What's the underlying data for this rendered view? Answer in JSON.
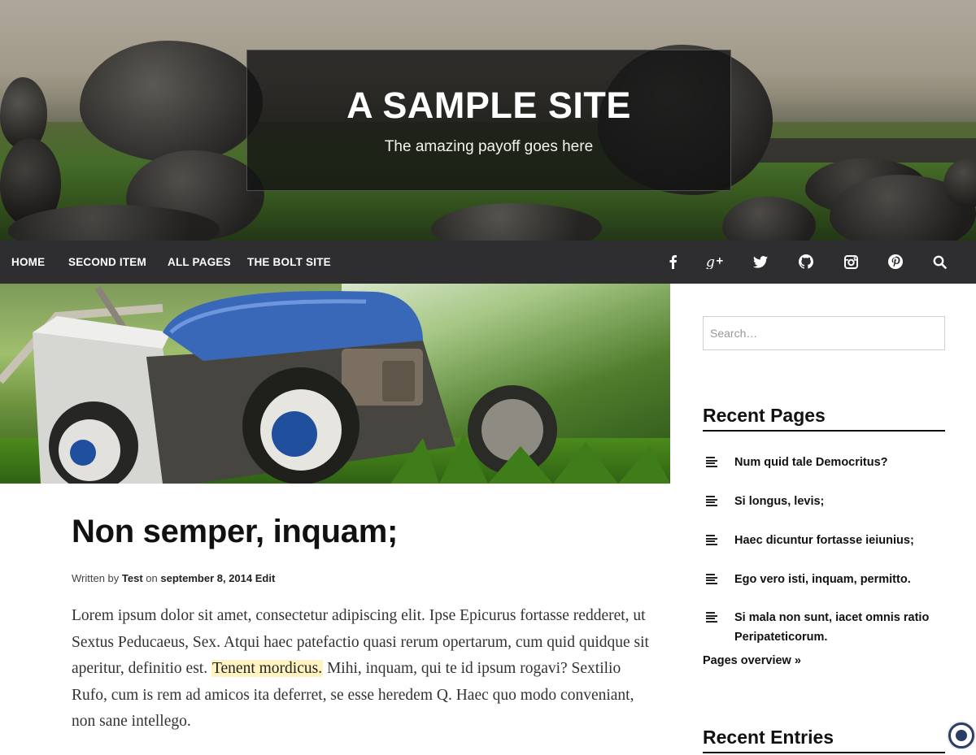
{
  "header": {
    "site_title": "A SAMPLE SITE",
    "tagline": "The amazing payoff goes here"
  },
  "nav": {
    "items": [
      {
        "label": "HOME"
      },
      {
        "label": "SECOND ITEM"
      },
      {
        "label": "ALL PAGES"
      },
      {
        "label": "THE BOLT SITE"
      }
    ],
    "social_icons": [
      "facebook-icon",
      "google-plus-icon",
      "twitter-icon",
      "github-icon",
      "instagram-icon",
      "pinterest-icon",
      "search-icon"
    ]
  },
  "post": {
    "title": "Non semper, inquam;",
    "meta_written_by": "Written by",
    "meta_author": "Test",
    "meta_on": "on",
    "meta_date": "september 8, 2014",
    "meta_edit": "Edit",
    "body_before": "Lorem ipsum dolor sit amet, consectetur adipiscing elit. Ipse Epicurus fortasse redderet, ut Sextus Peducaeus, Sex. Atqui haec patefactio quasi rerum opertarum, cum quid quidque sit aperitur, definitio est. ",
    "body_highlight": "Tenent mordicus.",
    "body_after": " Mihi, inquam, qui te id ipsum rogavi? Sextilio Rufo, cum is rem ad amicos ita deferret, se esse heredem Q. Haec quo modo conveniant, non sane intellego."
  },
  "sidebar": {
    "search_placeholder": "Search…",
    "recent_pages_title": "Recent Pages",
    "recent_pages": [
      "Num quid tale Democritus?",
      "Si longus, levis;",
      "Haec dicuntur fortasse ieiunius;",
      "Ego vero isti, inquam, permitto.",
      "Si mala non sunt, iacet omnis ratio Peripateticorum."
    ],
    "pages_overview": "Pages overview »",
    "recent_entries_title": "Recent Entries"
  },
  "colors": {
    "nav_bg": "#2e2e30",
    "highlight": "#fff3c2",
    "fab_accent": "#2c3d63"
  }
}
